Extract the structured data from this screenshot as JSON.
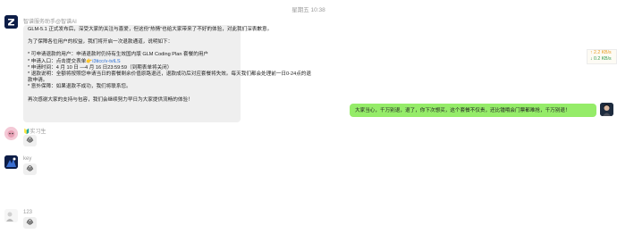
{
  "chat": {
    "timestamp": "星期五 10:38"
  },
  "messages": {
    "bot": {
      "sender": "智谱服务助手@智谱AI",
      "lines": [
        "GLM-5.1 正式发布后，深受大家的关注与喜爱，但这份“热情”也给大家带来了不好的体验，对此我们深表歉意。",
        "为了保障各位用户的权益，我们将开启一次退款通道，说明如下：",
        "* 可申请退款的用户：申请退款时仍持有生效国内版 GLM Coding Plan 套餐的用户",
        "* 申请入口：点击提交表单",
        "i3ticc/v-tvlLS",
        "* 申请时间：4 月 10 日 —4 月 16 日23:59:59（到期表单将关闭）",
        "* 退款说明：全额将按照您申请当日的套餐剩余价值原路退还，退款成功后对应套餐将失效。每天我们都会处理前一日0-24点的退",
        "款申请。",
        "* 意外保障：如果退款不成功，我们将联系您。",
        "再次感谢大家的支持与包容，我们会继续努力早日为大家提供流畅的体验！"
      ]
    },
    "self": {
      "text": "大家当心，千万别退，退了，你下次想买，这个套餐不仅贵，还比锺哦会门票都难抢，千万别退！"
    },
    "users": [
      {
        "name": "实习生",
        "emoji": "😂"
      },
      {
        "name": "key",
        "emoji": "😂"
      },
      {
        "name": "123",
        "emoji": "😂"
      }
    ]
  },
  "network": {
    "up": "↑ 2.2 KB/s",
    "down": "↓ 0.2 KB/s",
    "up_color": "#e69a1e",
    "down_color": "#2f9a4a"
  },
  "colors": {
    "self_bubble": "#95ec69",
    "other_bubble": "#efefef",
    "link": "#2a6fd6"
  }
}
